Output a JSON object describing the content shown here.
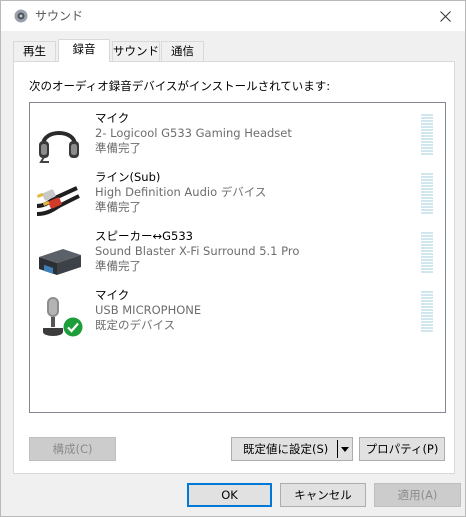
{
  "window": {
    "title": "サウンド",
    "close_label": "✕"
  },
  "tabs": [
    {
      "label": "再生"
    },
    {
      "label": "録音"
    },
    {
      "label": "サウンド"
    },
    {
      "label": "通信"
    }
  ],
  "active_tab": "録音",
  "panel": {
    "label": "次のオーディオ録音デバイスがインストールされています:"
  },
  "devices": [
    {
      "name": "マイク",
      "description": "2- Logicool G533 Gaming Headset",
      "status": "準備完了",
      "icon": "headset-icon"
    },
    {
      "name": "ライン(Sub)",
      "description": "High Definition Audio デバイス",
      "status": "準備完了",
      "icon": "audio-cable-icon"
    },
    {
      "name": "スピーカー↔G533",
      "description": "Sound Blaster X-Fi Surround 5.1 Pro",
      "status": "準備完了",
      "icon": "sound-card-icon"
    },
    {
      "name": "マイク",
      "description": "USB MICROPHONE",
      "status": "既定のデバイス",
      "icon": "microphone-icon",
      "default": true
    }
  ],
  "buttons": {
    "configure": "構成(C)",
    "set_default": "既定値に設定(S)",
    "properties": "プロパティ(P)",
    "ok": "OK",
    "cancel": "キャンセル",
    "apply": "適用(A)"
  },
  "colors": {
    "meter": "#d2e6ef",
    "default_check": "#1e9e3a"
  }
}
